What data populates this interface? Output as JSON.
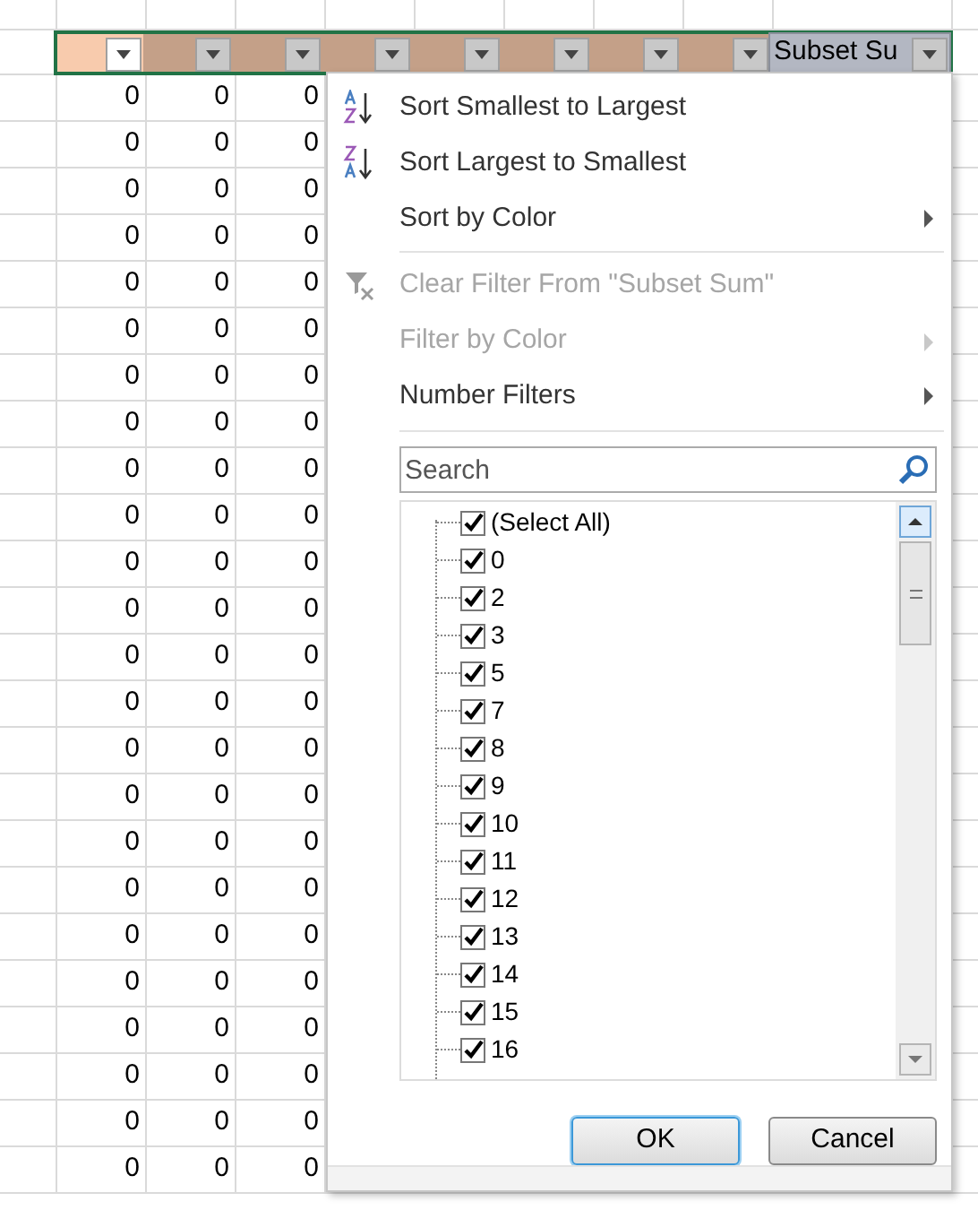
{
  "header_cells": [
    {
      "color": "#f8cbad",
      "selected": false,
      "filter_button_white": true
    },
    {
      "color": "#c4a088",
      "selected": false,
      "filter_button_white": false
    },
    {
      "color": "#c4a088",
      "selected": false,
      "filter_button_white": false
    },
    {
      "color": "#c4a088",
      "selected": false,
      "filter_button_white": false
    },
    {
      "color": "#c4a088",
      "selected": false,
      "filter_button_white": false
    },
    {
      "color": "#c4a088",
      "selected": false,
      "filter_button_white": false
    },
    {
      "color": "#c4a088",
      "selected": false,
      "filter_button_white": false
    },
    {
      "color": "#c4a088",
      "selected": false,
      "filter_button_white": false
    },
    {
      "label": "Subset Su",
      "color": "#b3b7c2",
      "selected": true,
      "filter_button_white": false
    }
  ],
  "rows": [
    [
      "0",
      "0",
      "0"
    ],
    [
      "0",
      "0",
      "0"
    ],
    [
      "0",
      "0",
      "0"
    ],
    [
      "0",
      "0",
      "0"
    ],
    [
      "0",
      "0",
      "0"
    ],
    [
      "0",
      "0",
      "0"
    ],
    [
      "0",
      "0",
      "0"
    ],
    [
      "0",
      "0",
      "0"
    ],
    [
      "0",
      "0",
      "0"
    ],
    [
      "0",
      "0",
      "0"
    ],
    [
      "0",
      "0",
      "0"
    ],
    [
      "0",
      "0",
      "0"
    ],
    [
      "0",
      "0",
      "0"
    ],
    [
      "0",
      "0",
      "0"
    ],
    [
      "0",
      "0",
      "0"
    ],
    [
      "0",
      "0",
      "0"
    ],
    [
      "0",
      "0",
      "0"
    ],
    [
      "0",
      "0",
      "0"
    ],
    [
      "0",
      "0",
      "0"
    ],
    [
      "0",
      "0",
      "0"
    ],
    [
      "0",
      "0",
      "0"
    ],
    [
      "0",
      "0",
      "0"
    ],
    [
      "0",
      "0",
      "0"
    ],
    [
      "0",
      "0",
      "0"
    ]
  ],
  "filter_menu": {
    "items": [
      {
        "kind": "sort_asc",
        "label": "Sort Smallest to Largest",
        "disabled": false,
        "submenu": false
      },
      {
        "kind": "sort_desc",
        "label": "Sort Largest to Smallest",
        "disabled": false,
        "submenu": false
      },
      {
        "kind": "plain",
        "label": "Sort by Color",
        "disabled": false,
        "submenu": true
      },
      {
        "kind": "separator"
      },
      {
        "kind": "clear",
        "label": "Clear Filter From \"Subset Sum\"",
        "disabled": true,
        "submenu": false
      },
      {
        "kind": "plain",
        "label": "Filter by Color",
        "disabled": true,
        "submenu": true
      },
      {
        "kind": "plain",
        "label": "Number Filters",
        "disabled": false,
        "submenu": true
      },
      {
        "kind": "separator"
      }
    ],
    "search": {
      "placeholder": "Search"
    },
    "values": [
      {
        "label": "(Select All)",
        "checked": true
      },
      {
        "label": "0",
        "checked": true
      },
      {
        "label": "2",
        "checked": true
      },
      {
        "label": "3",
        "checked": true
      },
      {
        "label": "5",
        "checked": true
      },
      {
        "label": "7",
        "checked": true
      },
      {
        "label": "8",
        "checked": true
      },
      {
        "label": "9",
        "checked": true
      },
      {
        "label": "10",
        "checked": true
      },
      {
        "label": "11",
        "checked": true
      },
      {
        "label": "12",
        "checked": true
      },
      {
        "label": "13",
        "checked": true
      },
      {
        "label": "14",
        "checked": true
      },
      {
        "label": "15",
        "checked": true
      },
      {
        "label": "16",
        "checked": true
      }
    ],
    "buttons": [
      "OK",
      "Cancel"
    ]
  }
}
